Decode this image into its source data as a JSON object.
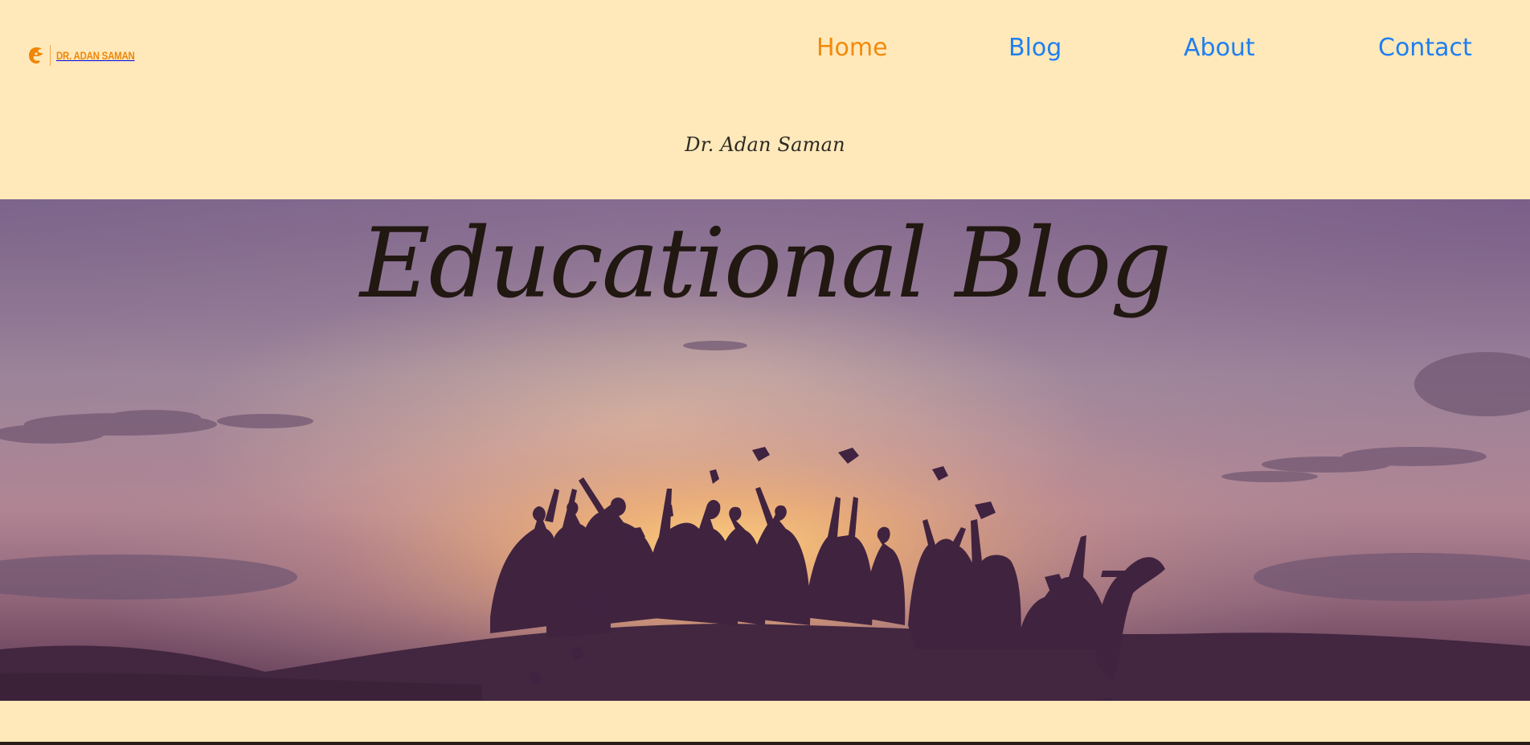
{
  "header": {
    "logo_text": "DR. ADAN SAMAN",
    "logo_icon": "eagle-head-icon",
    "nav": [
      {
        "label": "Home",
        "active": true
      },
      {
        "label": "Blog",
        "active": false
      },
      {
        "label": "About",
        "active": false
      },
      {
        "label": "Contact",
        "active": false
      }
    ],
    "site_title": "Dr. Adan Saman"
  },
  "hero": {
    "title": "Educational Blog",
    "background": "graduates-throwing-caps-sunset-photo"
  },
  "colors": {
    "page_bg": "#ffe9bb",
    "nav_link": "#1f7ff0",
    "nav_active": "#f28a0c",
    "logo": "#f0860a",
    "hero_title": "#211811",
    "silhouette": "#40233f"
  }
}
